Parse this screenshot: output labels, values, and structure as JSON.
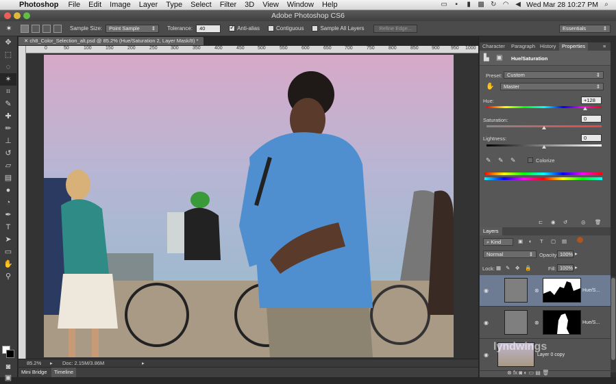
{
  "menubar": {
    "app": "Photoshop",
    "items": [
      "File",
      "Edit",
      "Image",
      "Layer",
      "Type",
      "Select",
      "Filter",
      "3D",
      "View",
      "Window",
      "Help"
    ],
    "clock": "Wed Mar 28  10:27 PM"
  },
  "window": {
    "title": "Adobe Photoshop CS6"
  },
  "options": {
    "sample_size_label": "Sample Size:",
    "sample_size_value": "Point Sample",
    "tolerance_label": "Tolerance:",
    "tolerance_value": "40",
    "anti_alias": "Anti-alias",
    "contiguous": "Contiguous",
    "sample_all": "Sample All Layers",
    "refine_edge": "Refine Edge...",
    "workspace": "Essentials"
  },
  "document": {
    "tab": "ch8_Color_Selection_alt.psd @ 85.2% (Hue/Saturation 2, Layer Mask/8) *",
    "ruler": [
      "0",
      "50",
      "100",
      "150",
      "200",
      "250",
      "300",
      "350",
      "400",
      "450",
      "500",
      "550",
      "600",
      "650",
      "700",
      "750",
      "800",
      "850",
      "900",
      "950",
      "1000"
    ],
    "zoom": "85.2%",
    "doc_info": "Doc: 2.15M/3.86M"
  },
  "bottom_tabs": [
    "Mini Bridge",
    "Timeline"
  ],
  "panel_tabs": [
    "Character",
    "Paragraph",
    "History",
    "Properties"
  ],
  "properties": {
    "title": "Hue/Saturation",
    "preset_label": "Preset:",
    "preset_value": "Custom",
    "channel_value": "Master",
    "hue_label": "Hue:",
    "hue_value": "+128",
    "hue_fraction": 0.856,
    "saturation_label": "Saturation:",
    "saturation_value": "0",
    "saturation_fraction": 0.5,
    "lightness_label": "Lightness:",
    "lightness_value": "0",
    "lightness_fraction": 0.5,
    "colorize": "Colorize"
  },
  "layers": {
    "title": "Layers",
    "kind": "Kind",
    "blend_mode": "Normal",
    "opacity_label": "Opacity:",
    "opacity_value": "100%",
    "lock_label": "Lock:",
    "fill_label": "Fill:",
    "fill_value": "100%",
    "items": [
      {
        "name": "Hue/S..."
      },
      {
        "name": "Hue/S..."
      },
      {
        "name": "Layer 0 copy"
      }
    ]
  },
  "watermark": "lyndwings"
}
